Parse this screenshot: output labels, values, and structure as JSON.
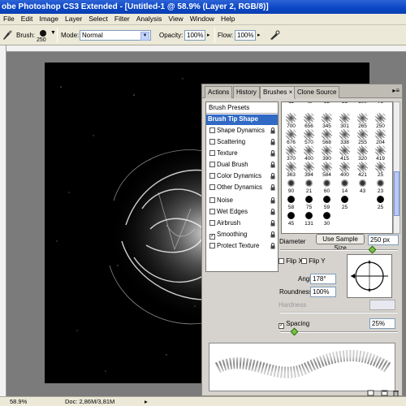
{
  "window": {
    "title": "obe Photoshop CS3 Extended - [Untitled-1 @ 58.9% (Layer 2, RGB/8)]"
  },
  "menu": [
    "File",
    "Edit",
    "Image",
    "Layer",
    "Select",
    "Filter",
    "Analysis",
    "View",
    "Window",
    "Help"
  ],
  "options": {
    "brush_label": "Brush:",
    "brush_size": "250",
    "mode_label": "Mode:",
    "mode_value": "Normal",
    "opacity_label": "Opacity:",
    "opacity_value": "100%",
    "flow_label": "Flow:",
    "flow_value": "100%"
  },
  "status": {
    "zoom": "58.9%",
    "doc": "Doc: 2,86M/3,81M"
  },
  "panel": {
    "tabs": [
      "Actions",
      "History",
      "Brushes",
      "Clone Source"
    ],
    "active_tab": "Brushes",
    "presets_label": "Brush Presets",
    "options": [
      {
        "label": "Brush Tip Shape",
        "selected": true,
        "checked": false,
        "lock": false
      },
      {
        "label": "Shape Dynamics",
        "selected": false,
        "checked": false,
        "lock": true
      },
      {
        "label": "Scattering",
        "selected": false,
        "checked": false,
        "lock": true
      },
      {
        "label": "Texture",
        "selected": false,
        "checked": false,
        "lock": true
      },
      {
        "label": "Dual Brush",
        "selected": false,
        "checked": false,
        "lock": true
      },
      {
        "label": "Color Dynamics",
        "selected": false,
        "checked": false,
        "lock": true
      },
      {
        "label": "Other Dynamics",
        "selected": false,
        "checked": false,
        "lock": true
      },
      {
        "label": "Noise",
        "selected": false,
        "checked": false,
        "lock": true
      },
      {
        "label": "Wet Edges",
        "selected": false,
        "checked": false,
        "lock": true
      },
      {
        "label": "Airbrush",
        "selected": false,
        "checked": false,
        "lock": true
      },
      {
        "label": "Smoothing",
        "selected": false,
        "checked": true,
        "lock": true
      },
      {
        "label": "Protect Texture",
        "selected": false,
        "checked": false,
        "lock": true
      }
    ],
    "brush_grid": [
      [
        "11",
        "48",
        "32",
        "55",
        "100",
        "75"
      ],
      [
        "700",
        "656",
        "345",
        "301",
        "265",
        "250"
      ],
      [
        "676",
        "570",
        "568",
        "338",
        "255",
        "204"
      ],
      [
        "370",
        "400",
        "390",
        "415",
        "320",
        "419"
      ],
      [
        "363",
        "394",
        "584",
        "400",
        "421",
        "25"
      ],
      [
        "90",
        "21",
        "60",
        "14",
        "43",
        "23"
      ],
      [
        "58",
        "75",
        "59",
        "25",
        "",
        "25"
      ],
      [
        "45",
        "131",
        "30",
        "",
        "",
        ""
      ]
    ],
    "diameter_label": "Diameter",
    "use_sample_size": "Use Sample Size",
    "diameter_value": "250 px",
    "flip_x": "Flip X",
    "flip_y": "Flip Y",
    "angle_label": "Angle:",
    "angle_value": "178°",
    "roundness_label": "Roundness:",
    "roundness_value": "100%",
    "hardness_label": "Hardness",
    "spacing_label": "Spacing",
    "spacing_value": "25%",
    "spacing_checked": true
  }
}
